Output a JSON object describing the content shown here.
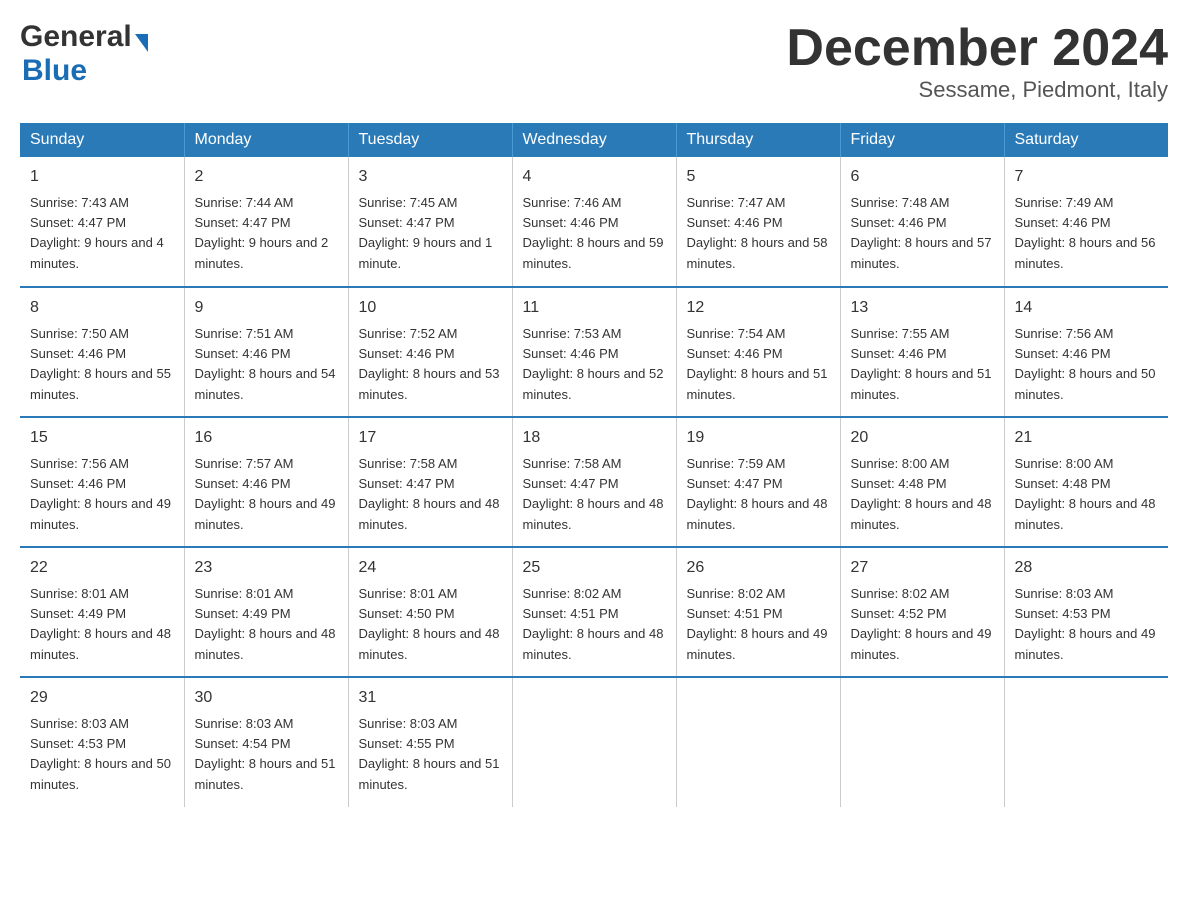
{
  "header": {
    "logo": {
      "general": "General",
      "blue": "Blue"
    },
    "month_title": "December 2024",
    "subtitle": "Sessame, Piedmont, Italy"
  },
  "weekdays": [
    "Sunday",
    "Monday",
    "Tuesday",
    "Wednesday",
    "Thursday",
    "Friday",
    "Saturday"
  ],
  "weeks": [
    [
      {
        "day": "1",
        "sunrise": "7:43 AM",
        "sunset": "4:47 PM",
        "daylight": "9 hours and 4 minutes."
      },
      {
        "day": "2",
        "sunrise": "7:44 AM",
        "sunset": "4:47 PM",
        "daylight": "9 hours and 2 minutes."
      },
      {
        "day": "3",
        "sunrise": "7:45 AM",
        "sunset": "4:47 PM",
        "daylight": "9 hours and 1 minute."
      },
      {
        "day": "4",
        "sunrise": "7:46 AM",
        "sunset": "4:46 PM",
        "daylight": "8 hours and 59 minutes."
      },
      {
        "day": "5",
        "sunrise": "7:47 AM",
        "sunset": "4:46 PM",
        "daylight": "8 hours and 58 minutes."
      },
      {
        "day": "6",
        "sunrise": "7:48 AM",
        "sunset": "4:46 PM",
        "daylight": "8 hours and 57 minutes."
      },
      {
        "day": "7",
        "sunrise": "7:49 AM",
        "sunset": "4:46 PM",
        "daylight": "8 hours and 56 minutes."
      }
    ],
    [
      {
        "day": "8",
        "sunrise": "7:50 AM",
        "sunset": "4:46 PM",
        "daylight": "8 hours and 55 minutes."
      },
      {
        "day": "9",
        "sunrise": "7:51 AM",
        "sunset": "4:46 PM",
        "daylight": "8 hours and 54 minutes."
      },
      {
        "day": "10",
        "sunrise": "7:52 AM",
        "sunset": "4:46 PM",
        "daylight": "8 hours and 53 minutes."
      },
      {
        "day": "11",
        "sunrise": "7:53 AM",
        "sunset": "4:46 PM",
        "daylight": "8 hours and 52 minutes."
      },
      {
        "day": "12",
        "sunrise": "7:54 AM",
        "sunset": "4:46 PM",
        "daylight": "8 hours and 51 minutes."
      },
      {
        "day": "13",
        "sunrise": "7:55 AM",
        "sunset": "4:46 PM",
        "daylight": "8 hours and 51 minutes."
      },
      {
        "day": "14",
        "sunrise": "7:56 AM",
        "sunset": "4:46 PM",
        "daylight": "8 hours and 50 minutes."
      }
    ],
    [
      {
        "day": "15",
        "sunrise": "7:56 AM",
        "sunset": "4:46 PM",
        "daylight": "8 hours and 49 minutes."
      },
      {
        "day": "16",
        "sunrise": "7:57 AM",
        "sunset": "4:46 PM",
        "daylight": "8 hours and 49 minutes."
      },
      {
        "day": "17",
        "sunrise": "7:58 AM",
        "sunset": "4:47 PM",
        "daylight": "8 hours and 48 minutes."
      },
      {
        "day": "18",
        "sunrise": "7:58 AM",
        "sunset": "4:47 PM",
        "daylight": "8 hours and 48 minutes."
      },
      {
        "day": "19",
        "sunrise": "7:59 AM",
        "sunset": "4:47 PM",
        "daylight": "8 hours and 48 minutes."
      },
      {
        "day": "20",
        "sunrise": "8:00 AM",
        "sunset": "4:48 PM",
        "daylight": "8 hours and 48 minutes."
      },
      {
        "day": "21",
        "sunrise": "8:00 AM",
        "sunset": "4:48 PM",
        "daylight": "8 hours and 48 minutes."
      }
    ],
    [
      {
        "day": "22",
        "sunrise": "8:01 AM",
        "sunset": "4:49 PM",
        "daylight": "8 hours and 48 minutes."
      },
      {
        "day": "23",
        "sunrise": "8:01 AM",
        "sunset": "4:49 PM",
        "daylight": "8 hours and 48 minutes."
      },
      {
        "day": "24",
        "sunrise": "8:01 AM",
        "sunset": "4:50 PM",
        "daylight": "8 hours and 48 minutes."
      },
      {
        "day": "25",
        "sunrise": "8:02 AM",
        "sunset": "4:51 PM",
        "daylight": "8 hours and 48 minutes."
      },
      {
        "day": "26",
        "sunrise": "8:02 AM",
        "sunset": "4:51 PM",
        "daylight": "8 hours and 49 minutes."
      },
      {
        "day": "27",
        "sunrise": "8:02 AM",
        "sunset": "4:52 PM",
        "daylight": "8 hours and 49 minutes."
      },
      {
        "day": "28",
        "sunrise": "8:03 AM",
        "sunset": "4:53 PM",
        "daylight": "8 hours and 49 minutes."
      }
    ],
    [
      {
        "day": "29",
        "sunrise": "8:03 AM",
        "sunset": "4:53 PM",
        "daylight": "8 hours and 50 minutes."
      },
      {
        "day": "30",
        "sunrise": "8:03 AM",
        "sunset": "4:54 PM",
        "daylight": "8 hours and 51 minutes."
      },
      {
        "day": "31",
        "sunrise": "8:03 AM",
        "sunset": "4:55 PM",
        "daylight": "8 hours and 51 minutes."
      },
      null,
      null,
      null,
      null
    ]
  ],
  "labels": {
    "sunrise": "Sunrise:",
    "sunset": "Sunset:",
    "daylight": "Daylight:"
  }
}
